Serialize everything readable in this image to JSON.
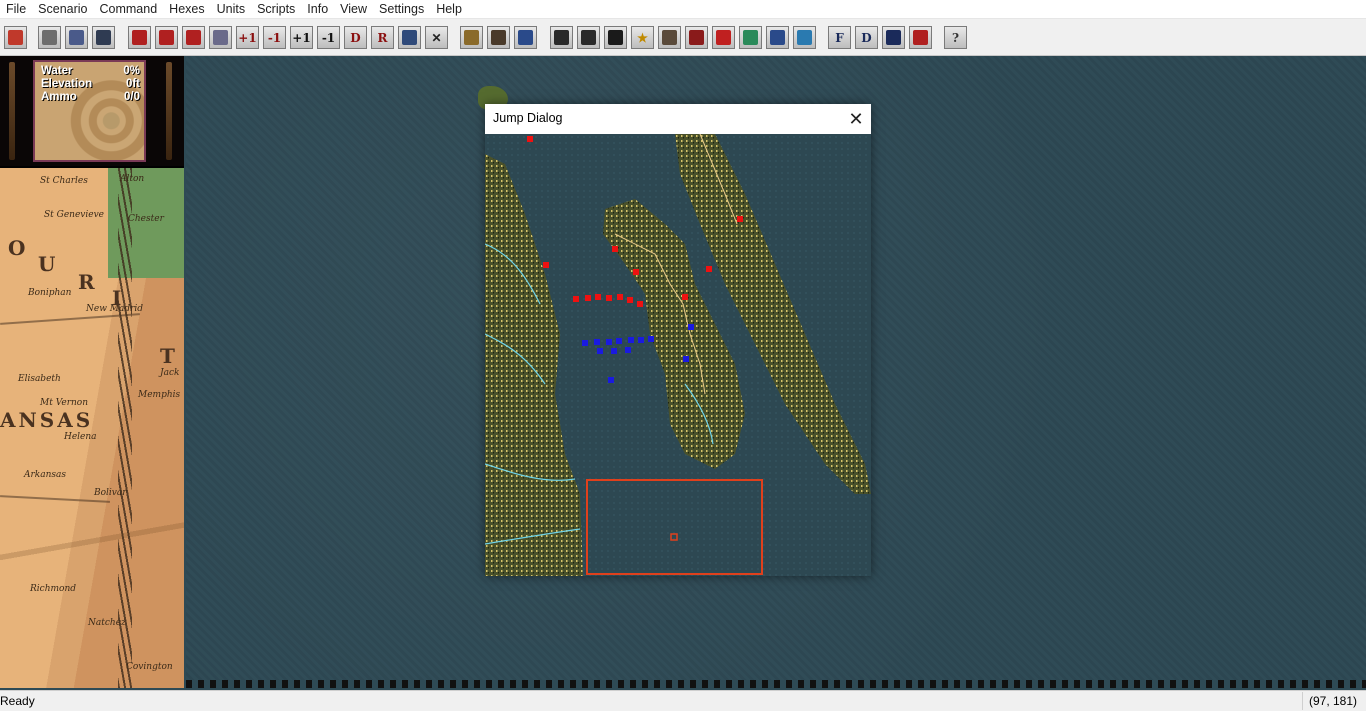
{
  "menu": [
    "File",
    "Scenario",
    "Command",
    "Hexes",
    "Units",
    "Scripts",
    "Info",
    "View",
    "Settings",
    "Help"
  ],
  "toolbar": {
    "buttons": [
      {
        "name": "new-hex-icon",
        "label": "",
        "color": "#c0392b"
      },
      {
        "name": "open-scenario-icon",
        "label": "",
        "color": "#6d6d6d"
      },
      {
        "name": "open-folder-icon",
        "label": "",
        "color": "#4a5a8a"
      },
      {
        "name": "save-icon",
        "label": "",
        "color": "#2f3b52"
      },
      {
        "name": "red-cannon-icon",
        "label": "",
        "color": "#b02020"
      },
      {
        "name": "red-wagon-icon",
        "label": "",
        "color": "#b02020"
      },
      {
        "name": "red-supply-icon",
        "label": "",
        "color": "#b02020"
      },
      {
        "name": "helmet-icon",
        "label": "",
        "color": "#6a6a8a"
      },
      {
        "name": "plus-one-red",
        "label": "+1",
        "color": "#8b1010"
      },
      {
        "name": "minus-one-red",
        "label": "-1",
        "color": "#8b1010"
      },
      {
        "name": "plus-one-black",
        "label": "+1",
        "color": "#111"
      },
      {
        "name": "minus-one-black",
        "label": "-1",
        "color": "#111"
      },
      {
        "name": "d-button",
        "label": "D",
        "color": "#8b1010"
      },
      {
        "name": "r-button",
        "label": "R",
        "color": "#8b1010"
      },
      {
        "name": "shield-icon",
        "label": "",
        "color": "#2f4a7a"
      },
      {
        "name": "cancel-x-icon",
        "label": "✕",
        "color": "#222"
      },
      {
        "name": "column-icon",
        "label": "",
        "color": "#8a6a2a"
      },
      {
        "name": "terrain-icon",
        "label": "",
        "color": "#4a3a2a"
      },
      {
        "name": "stack-icon",
        "label": "",
        "color": "#2a4a8a"
      },
      {
        "name": "zoom-in-icon",
        "label": "",
        "color": "#2a2a2a"
      },
      {
        "name": "zoom-out-icon",
        "label": "",
        "color": "#2a2a2a"
      },
      {
        "name": "frame-icon",
        "label": "",
        "color": "#1a1a1a"
      },
      {
        "name": "star-icon",
        "label": "★",
        "color": "#c08a00"
      },
      {
        "name": "grid-icon",
        "label": "",
        "color": "#5a4a3a"
      },
      {
        "name": "target-icon",
        "label": "",
        "color": "#8a1a1a"
      },
      {
        "name": "red-diamond-icon",
        "label": "",
        "color": "#c02020"
      },
      {
        "name": "hex-outline-icon",
        "label": "",
        "color": "#2a8a5a"
      },
      {
        "name": "move-arrows-icon",
        "label": "",
        "color": "#2a4a8a"
      },
      {
        "name": "map-icon",
        "label": "",
        "color": "#2a7ab0"
      },
      {
        "name": "f-button",
        "label": "F",
        "color": "#1a2a5a"
      },
      {
        "name": "d-blue-button",
        "label": "D",
        "color": "#1a2a5a"
      },
      {
        "name": "binoculars-icon",
        "label": "",
        "color": "#1a2a5a"
      },
      {
        "name": "flag-icon",
        "label": "",
        "color": "#b02020"
      },
      {
        "name": "help-icon",
        "label": "?",
        "color": "#333"
      }
    ]
  },
  "terrain_info": {
    "rows": [
      {
        "label": "Water",
        "value": "0%"
      },
      {
        "label": "Elevation",
        "value": "0ft"
      },
      {
        "label": "Ammo",
        "value": "0/0"
      }
    ]
  },
  "minimap": {
    "labels": {
      "st_charles": "St Charles",
      "st_genevieve": "St Genevieve",
      "chester": "Chester",
      "bonipham": "Boniphan",
      "new_madrid": "New Madrid",
      "elisabeth": "Elisabeth",
      "mt_vernon": "Mt Vernon",
      "helena": "Helena",
      "arkansas_post": "Arkansas",
      "bolivar": "Bolivar",
      "richmond": "Richmond",
      "natchez": "Natchez",
      "covington": "Covington",
      "memphis": "Memphis",
      "jackson": "Jack",
      "alton": "Alton",
      "state_u": "U",
      "state_r": "R",
      "state_o": "O",
      "state_i": "I",
      "state_t": "T",
      "state_ansas": "ANSAS"
    }
  },
  "dialog": {
    "title": "Jump Dialog",
    "close_glyph": "✕"
  },
  "jump_map": {
    "red_units": 14,
    "blue_units": 13
  },
  "status": {
    "text": "Ready",
    "coords": "(97, 181)"
  }
}
